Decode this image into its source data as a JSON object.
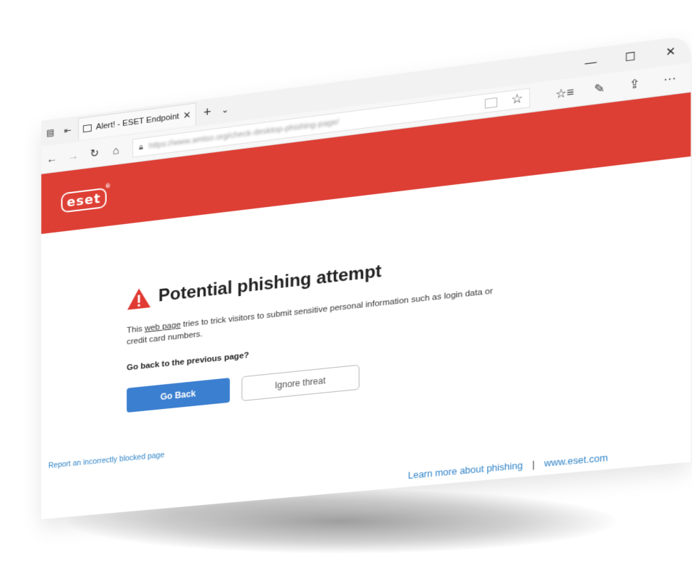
{
  "tabbar": {
    "tab_title": "Alert! - ESET Endpoint S",
    "tab_close": "✕",
    "new_tab": "+",
    "tab_list": "⌄",
    "window": {
      "minimize": "—",
      "maximize": "☐",
      "close": "✕"
    }
  },
  "navbar": {
    "back": "←",
    "forward": "→",
    "refresh": "↻",
    "home": "⌂",
    "url": "https://www.amtso.org/check-desktop-phishing-page/",
    "favorite": "☆",
    "tools": {
      "favorites": "☆≡",
      "notes": "✎",
      "share": "⇪",
      "more": "···"
    }
  },
  "header": {
    "logo_text": "eset",
    "logo_reg": "®",
    "color": "#dd3f35"
  },
  "alert": {
    "title": "Potential phishing attempt",
    "desc_prefix": "This ",
    "desc_link": "web page",
    "desc_suffix": " tries to trick visitors to submit sensitive personal information such as login data or credit card numbers.",
    "question": "Go back to the previous page?",
    "go_back": "Go Back",
    "ignore": "Ignore threat"
  },
  "footer": {
    "report": "Report an incorrectly blocked page",
    "learn_more": "Learn more about phishing",
    "separator": "|",
    "site": "www.eset.com"
  },
  "colors": {
    "accent": "#dd3f35",
    "primary_button": "#3b7fd0",
    "link": "#2f83c7"
  }
}
